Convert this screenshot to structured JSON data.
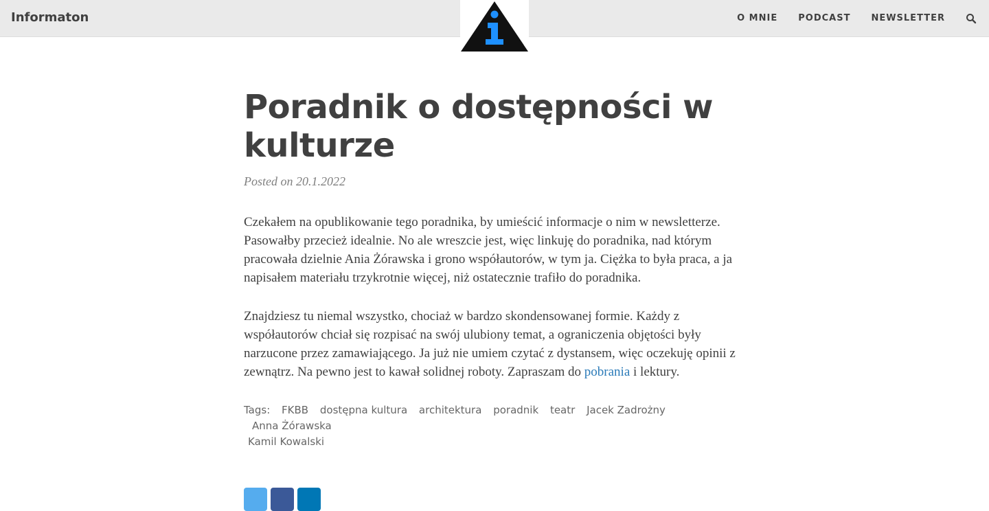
{
  "header": {
    "brand": "Informaton",
    "nav": [
      "O MNIE",
      "PODCAST",
      "NEWSLETTER"
    ],
    "logo_icon": "info-triangle-logo",
    "search_icon": "search-icon"
  },
  "post": {
    "title": "Poradnik o dostępności w kulturze",
    "posted_prefix": "Posted on",
    "date": "20.1.2022",
    "paragraph1": "Czekałem na opublikowanie tego poradnika, by umieścić informacje o nim w newsletterze. Pasowałby przecież idealnie. No ale wreszcie jest, więc linkuję do poradnika, nad którym pracowała dzielnie Ania Żórawska i grono współautorów, w tym ja. Ciężka to była praca, a ja napisałem materiału trzykrotnie więcej, niż ostatecznie trafiło do poradnika.",
    "paragraph2_before": "Znajdziesz tu niemal wszystko, chociaż w bardzo skondensowanej formie. Każdy z współautorów chciał się rozpisać na swój ulubiony temat, a ograniczenia objętości były narzucone przez zamawiającego. Ja już nie umiem czytać z dystansem, więc oczekuję opinii z zewnątrz. Na pewno jest to kawał solidnej roboty. Zapraszam do",
    "paragraph2_link": "pobrania",
    "paragraph2_after": "i lektury."
  },
  "tags": {
    "label": "Tags:",
    "items": [
      "FKBB",
      "dostępna kultura",
      "architektura",
      "poradnik",
      "teatr",
      "Jacek Zadrożny",
      "Anna Żórawska",
      "Kamil Kowalski"
    ]
  },
  "share": {
    "buttons": [
      "twitter-icon",
      "facebook-icon",
      "linkedin-icon"
    ]
  },
  "colors": {
    "header_bg": "#eaeaea",
    "text": "#404040",
    "link": "#2a7ab8",
    "logo_blue": "#1e90ff",
    "twitter": "#55acee",
    "facebook": "#3b5998",
    "linkedin": "#0077b5"
  }
}
